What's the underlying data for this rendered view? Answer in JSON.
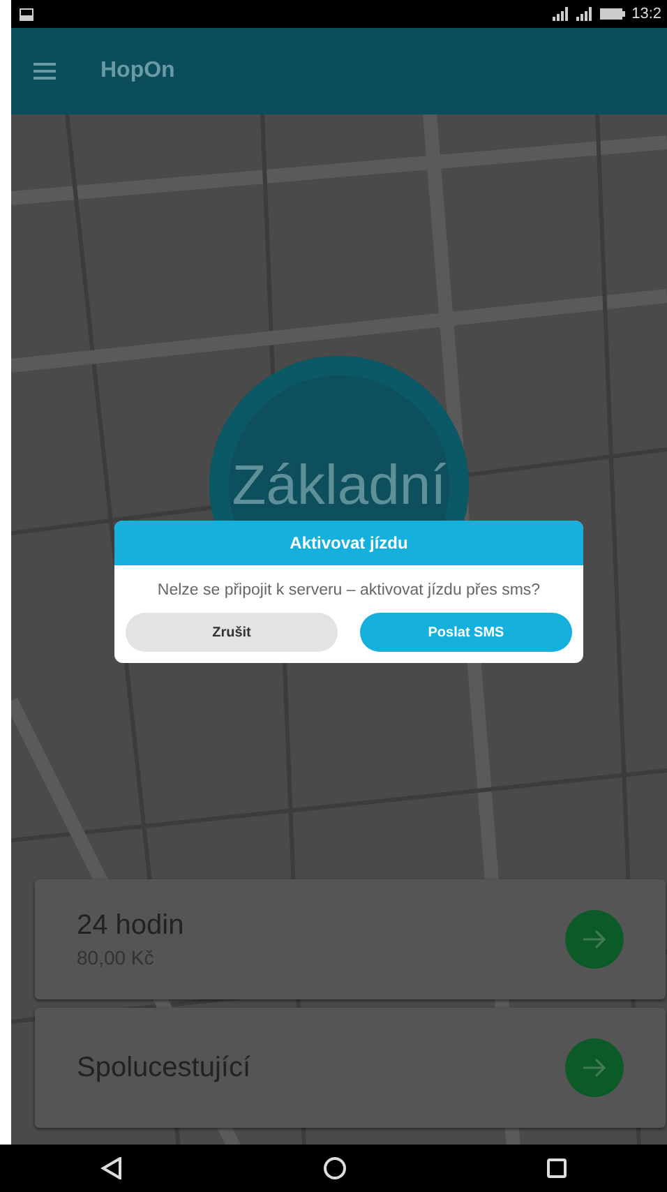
{
  "status_bar": {
    "time": "13:2"
  },
  "app_bar": {
    "title": "HopOn"
  },
  "zone_button": {
    "label": "Základní"
  },
  "tickets": [
    {
      "title": "24 hodin",
      "price": "80,00 Kč"
    },
    {
      "title": "Spolucestující"
    }
  ],
  "dialog": {
    "title": "Aktivovat jízdu",
    "message": "Nelze se připojit k serveru – aktivovat jízdu přes sms?",
    "buttons": [
      {
        "label": "Zrušit",
        "kind": "cancel"
      },
      {
        "label": "Poslat SMS",
        "kind": "primary"
      }
    ]
  }
}
